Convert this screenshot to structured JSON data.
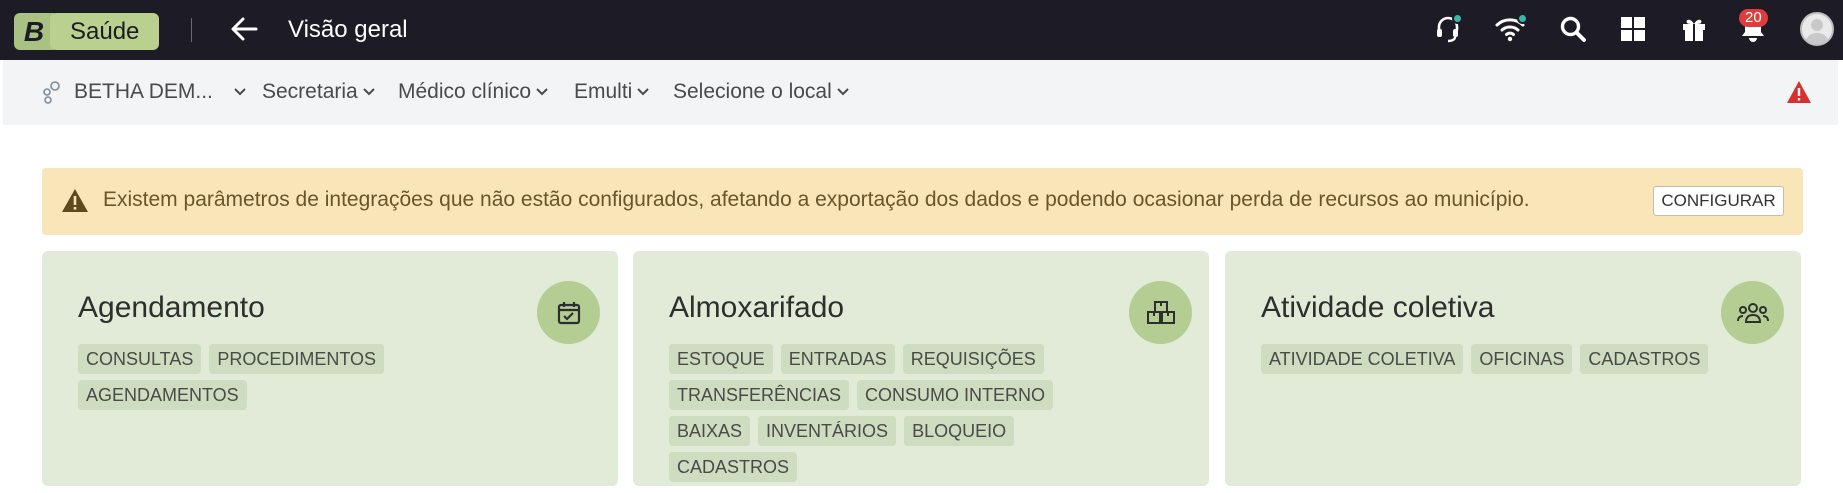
{
  "topbar": {
    "brand_letter": "B",
    "brand_name": "Saúde",
    "page_title": "Visão geral",
    "notification_count": "20",
    "icons": [
      "headset-icon",
      "wifi-icon",
      "search-icon",
      "apps-grid-icon",
      "gift-icon",
      "bell-icon",
      "avatar"
    ]
  },
  "context": {
    "entity": "BETHA DEM...",
    "secretaria": "Secretaria",
    "role": "Médico clínico",
    "team": "Emulti",
    "location": "Selecione o local"
  },
  "alert": {
    "message": "Existem parâmetros de integrações que não estão configurados, afetando a exportação dos dados e podendo ocasionar perda de recursos ao município.",
    "button": "CONFIGURAR"
  },
  "cards": [
    {
      "title": "Agendamento",
      "icon": "calendar-check-icon",
      "tags": [
        "CONSULTAS",
        "PROCEDIMENTOS",
        "AGENDAMENTOS"
      ]
    },
    {
      "title": "Almoxarifado",
      "icon": "boxes-icon",
      "tags": [
        "ESTOQUE",
        "ENTRADAS",
        "REQUISIÇÕES",
        "TRANSFERÊNCIAS",
        "CONSUMO INTERNO",
        "BAIXAS",
        "INVENTÁRIOS",
        "BLOQUEIO",
        "CADASTROS"
      ]
    },
    {
      "title": "Atividade coletiva",
      "icon": "group-icon",
      "tags": [
        "ATIVIDADE COLETIVA",
        "OFICINAS",
        "CADASTROS"
      ]
    }
  ],
  "colors": {
    "topbar_bg": "#1d1c26",
    "brand_green": "#b9d08f",
    "alert_bg": "#f8e6b9",
    "card_bg": "#e1ebd8",
    "badge_red": "#e03c3c",
    "status_dot": "#38b7a6"
  }
}
